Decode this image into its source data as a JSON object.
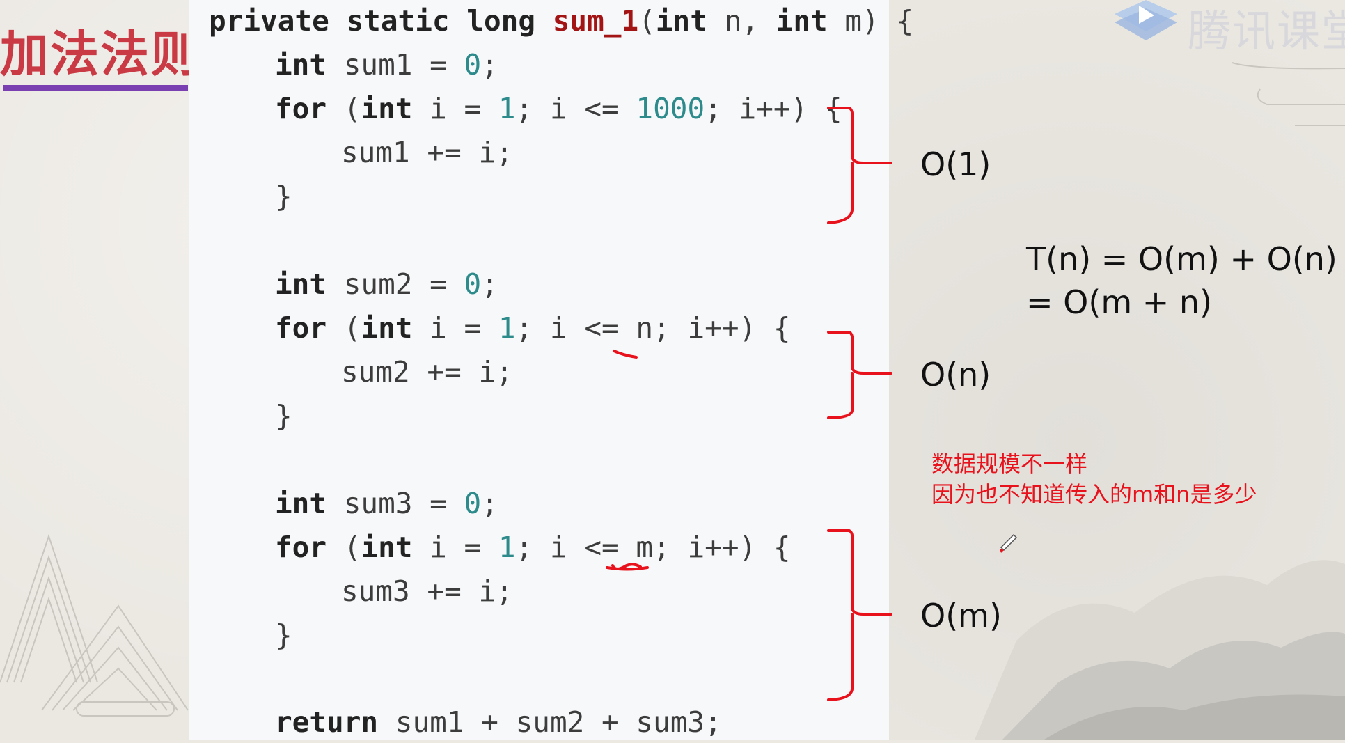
{
  "slide": {
    "section_title": "加法法则",
    "logo_text": "腾讯课堂"
  },
  "code": {
    "lines": [
      "private static long sum_1(int n, int m) {",
      "int sum1 = 0;",
      "for (int i = 1; i <= 1000; i++) {",
      "sum1 += i;",
      "}",
      "int sum2 = 0;",
      "for (int i = 1; i <= n; i++) {",
      "sum2 += i;",
      "}",
      "int sum3 = 0;",
      "for (int i = 1; i <= m; i++) {",
      "sum3 += i;",
      "}",
      "return sum1 + sum2 + sum3;"
    ]
  },
  "annotations": {
    "complexity_1": "O(1)",
    "complexity_2": "O(n)",
    "complexity_3": "O(m)",
    "formula_line1": "T(n) = O(m) + O(n)",
    "formula_line2": "= O(m + n)",
    "note_line1": "数据规模不一样",
    "note_line2": "因为也不知道传入的m和n是多少"
  },
  "colors": {
    "annotation_red": "#e8121d",
    "title_red": "#c93a44",
    "underline_purple": "#7a3fb0",
    "code_keyword": "#222222",
    "code_number": "#2e8b8b",
    "code_function": "#a31515"
  },
  "icons": {
    "logo": "play-triangle-icon",
    "pen_cursor": "pen-icon"
  }
}
